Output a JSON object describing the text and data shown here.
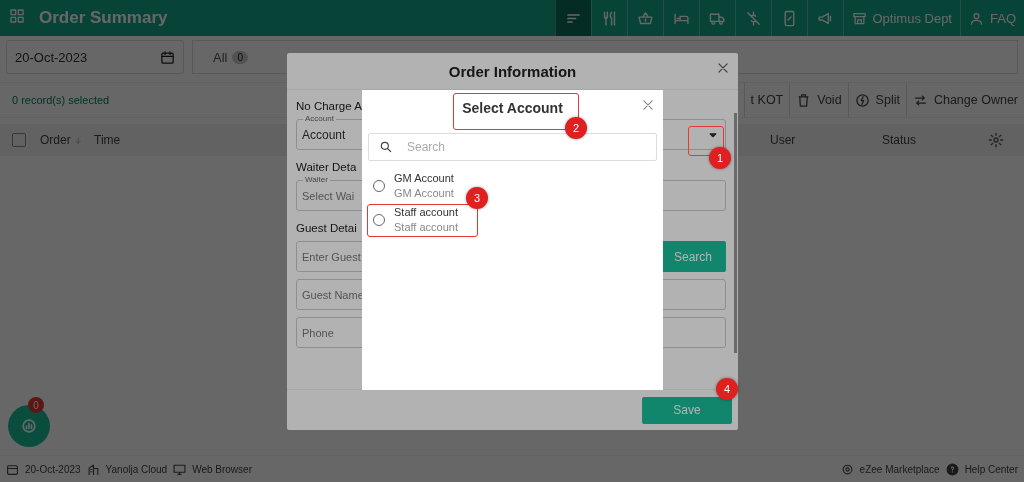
{
  "header": {
    "title": "Order Summary",
    "nav_icons": [
      {
        "kind": "sort",
        "selected": true
      },
      {
        "kind": "utensils",
        "selected": false
      },
      {
        "kind": "basket",
        "selected": false
      },
      {
        "kind": "bed",
        "selected": false
      },
      {
        "kind": "truck",
        "selected": false
      },
      {
        "kind": "slash",
        "selected": false
      },
      {
        "kind": "phone",
        "selected": false
      },
      {
        "kind": "megaphone",
        "selected": false
      }
    ],
    "dept": "Optimus Dept",
    "faq": "FAQ"
  },
  "date_field": {
    "value": "20-Oct-2023"
  },
  "tabs": [
    {
      "label": "All",
      "count": "0",
      "selected": false
    }
  ],
  "records": "0 record(s) selected",
  "toolbar": [
    {
      "label": "t KOT",
      "kind": "text"
    },
    {
      "label": "Void",
      "kind": "trash"
    },
    {
      "label": "Split",
      "kind": "split"
    },
    {
      "label": "Change Owner",
      "kind": "swap"
    }
  ],
  "table": {
    "select_all": {
      "checked": false
    },
    "columns": [
      {
        "label": "Order",
        "sortable": true
      },
      {
        "label": "Time",
        "sortable": false
      },
      {
        "label": "User",
        "sortable": false
      },
      {
        "label": "Status",
        "sortable": false
      }
    ]
  },
  "order_modal": {
    "title": "Order Information",
    "no_charge": "No Charge A",
    "account": {
      "label": "Account",
      "value": "Account"
    },
    "waiter_heading": "Waiter Deta",
    "waiter": {
      "label": "Waiter",
      "placeholder": "Select Wai"
    },
    "guest_heading": "Guest Detai",
    "guest_search": {
      "placeholder": "Enter Guest"
    },
    "search_button": "Search",
    "guest_name": {
      "placeholder": "Guest Name"
    },
    "phone": {
      "placeholder": "Phone"
    },
    "save_button": "Save"
  },
  "account_modal": {
    "title": "Select Account",
    "search": {
      "placeholder": "Search"
    },
    "options": [
      {
        "name": "GM Account",
        "sub": "GM Account",
        "selected": false
      },
      {
        "name": "Staff account",
        "sub": "Staff account",
        "selected": false
      }
    ]
  },
  "annotations": [
    {
      "number": "1"
    },
    {
      "number": "2"
    },
    {
      "number": "3"
    },
    {
      "number": "4"
    }
  ],
  "fab": {
    "badge": "0"
  },
  "footer": {
    "date": "20-Oct-2023",
    "property": "Yanolja Cloud",
    "device": "Web Browser",
    "marketplace": "eZee Marketplace",
    "help": "Help Center"
  }
}
